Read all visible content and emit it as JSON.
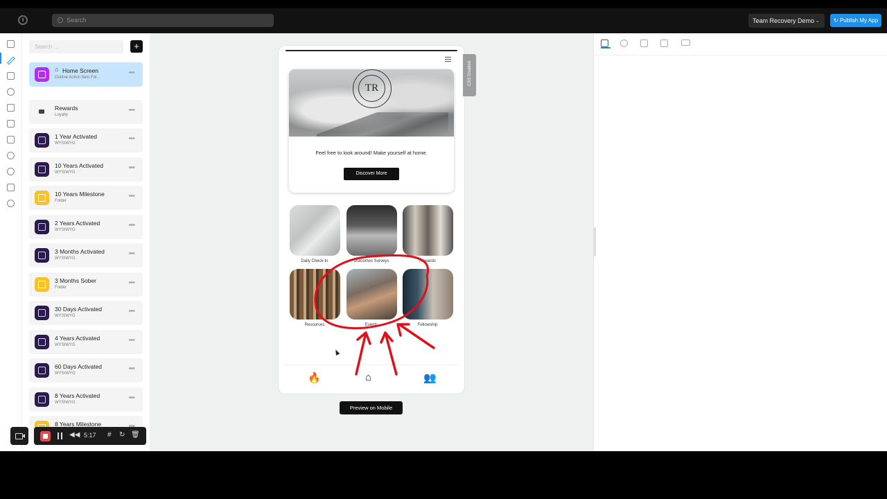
{
  "topbar": {
    "search_placeholder": "Search",
    "workspace_name": "Team Recovery Demo",
    "publish_label": "Publish My App"
  },
  "panel": {
    "search_placeholder": "Search ...",
    "add_label": "+",
    "items": [
      {
        "name": "Home Screen",
        "sub": "Outline Action Item Fol...",
        "icon": "screen-icon"
      },
      {
        "name": "Rewards",
        "sub": "Loyalty",
        "icon": "cart-icon"
      },
      {
        "name": "1 Year Activated",
        "sub": "WYSIWYG",
        "icon": "wysiwyg-icon"
      },
      {
        "name": "10 Years Activated",
        "sub": "WYSIWYG",
        "icon": "wysiwyg-icon"
      },
      {
        "name": "10 Years Milestone",
        "sub": "Folder",
        "icon": "folder-icon"
      },
      {
        "name": "2 Years Activated",
        "sub": "WYSIWYG",
        "icon": "wysiwyg-icon"
      },
      {
        "name": "3 Months Activated",
        "sub": "WYSIWYG",
        "icon": "wysiwyg-icon"
      },
      {
        "name": "3 Months Sober",
        "sub": "Folder",
        "icon": "folder-icon"
      },
      {
        "name": "30 Days Activated",
        "sub": "WYSIWYG",
        "icon": "wysiwyg-icon"
      },
      {
        "name": "4 Years Activated",
        "sub": "WYSIWYG",
        "icon": "wysiwyg-icon"
      },
      {
        "name": "60 Days Activated",
        "sub": "WYSIWYG",
        "icon": "wysiwyg-icon"
      },
      {
        "name": "8 Years Activated",
        "sub": "WYSIWYG",
        "icon": "wysiwyg-icon"
      },
      {
        "name": "8 Years Milestone",
        "sub": "",
        "icon": "folder-icon"
      }
    ]
  },
  "recorder": {
    "time": "5:17"
  },
  "phone": {
    "logo_letters": "TR",
    "tagline": "Feel free to look around! Make yourself at home.",
    "cta_label": "Discover More",
    "tiles": [
      {
        "label": "Daily Check-In"
      },
      {
        "label": "Outcomes Surveys"
      },
      {
        "label": "Rewards"
      },
      {
        "label": "Resources"
      },
      {
        "label": "Events"
      },
      {
        "label": "Fellowship"
      }
    ]
  },
  "canvas": {
    "css_tab_label": "CSS Enabled",
    "preview_label": "Preview on Mobile"
  },
  "colors": {
    "accent": "#1e90e8",
    "annotation": "#e0101b",
    "selected_item": "#c6e4fb"
  }
}
